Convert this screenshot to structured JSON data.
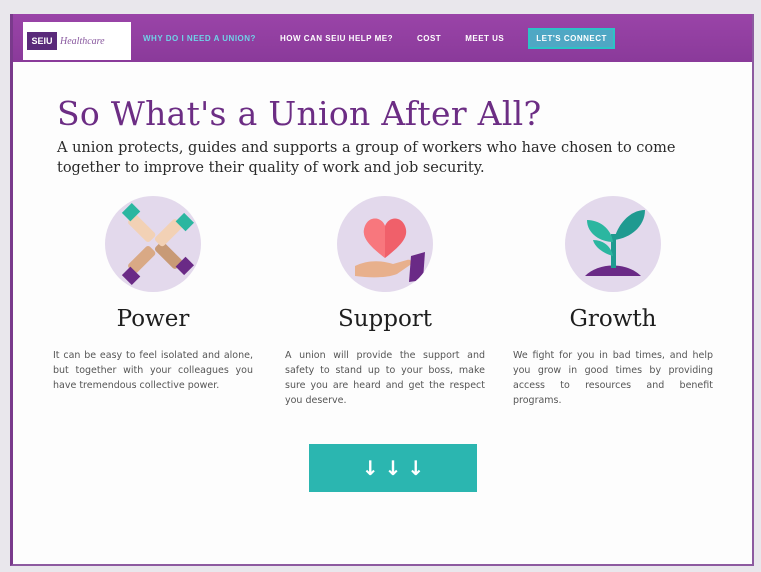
{
  "nav": {
    "logo_mark": "SEIU",
    "logo_text": "Healthcare",
    "links": [
      {
        "label": "WHY DO I NEED A UNION?"
      },
      {
        "label": "HOW CAN SEIU HELP ME?"
      },
      {
        "label": "COST"
      },
      {
        "label": "MEET US"
      }
    ],
    "cta": "LET'S CONNECT"
  },
  "hero": {
    "title": "So What's a Union After All?",
    "subtitle": "A union protects, guides and supports a group of workers who have chosen to come together to improve their quality of work and job security."
  },
  "features": [
    {
      "icon": "linked-hands-icon",
      "title": "Power",
      "description": "It can be easy to feel isolated and alone, but together with your colleagues you have tremendous collective power."
    },
    {
      "icon": "heart-in-hand-icon",
      "title": "Support",
      "description": "A union will provide the support and safety to stand up to your boss, make sure you are heard and get the respect you deserve."
    },
    {
      "icon": "sprout-icon",
      "title": "Growth",
      "description": "We fight for you in bad times, and help you grow in good times by providing access to resources and benefit programs."
    }
  ],
  "cta_button": {
    "icon": "down-arrows-icon",
    "glyphs": [
      "↓",
      "↓",
      "↓"
    ]
  },
  "colors": {
    "nav_bg": "#8a3a9a",
    "accent_teal": "#2bb6b0",
    "title_purple": "#6c2d84",
    "icon_circle": "#e3d9ec"
  }
}
